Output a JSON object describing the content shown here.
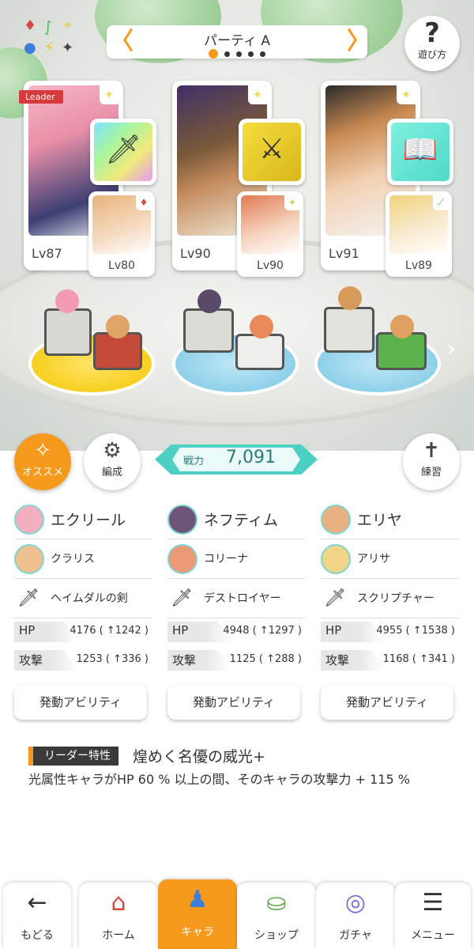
{
  "party": {
    "title": "パーティ A",
    "page_count": 5,
    "active_page": 1
  },
  "help": {
    "label": "遊び方",
    "icon": "question-icon"
  },
  "members": [
    {
      "leader_label": "Leader",
      "level": "Lv87",
      "weapon_icon": "sword-icon",
      "sub_level": "Lv80",
      "sub_badge": "♦"
    },
    {
      "level": "Lv90",
      "weapon_icon": "spear-icon",
      "sub_level": "Lv90",
      "sub_badge": "✦"
    },
    {
      "level": "Lv91",
      "weapon_icon": "book-icon",
      "sub_level": "Lv89",
      "sub_badge": "⟋"
    }
  ],
  "buttons": {
    "recommend": "オススメ",
    "formation": "編成",
    "practice": "練習"
  },
  "power": {
    "label": "戦力",
    "value": "7,091"
  },
  "columns": [
    {
      "main": "エクリール",
      "sub": "クラリス",
      "weapon": "ヘイムダルの剣",
      "hp_label": "HP",
      "hp": "4176 ( ↑1242 )",
      "atk_label": "攻撃",
      "atk": "1253 ( ↑336 )",
      "ability": "発動アビリティ"
    },
    {
      "main": "ネフティム",
      "sub": "コリーナ",
      "weapon": "デストロイヤー",
      "hp_label": "HP",
      "hp": "4948 ( ↑1297 )",
      "atk_label": "攻撃",
      "atk": "1125 ( ↑288 )",
      "ability": "発動アビリティ"
    },
    {
      "main": "エリヤ",
      "sub": "アリサ",
      "weapon": "スクリプチャー",
      "hp_label": "HP",
      "hp": "4955 ( ↑1538 )",
      "atk_label": "攻撃",
      "atk": "1168 ( ↑341 )",
      "ability": "発動アビリティ"
    }
  ],
  "leader_skill": {
    "tag": "リーダー特性",
    "name": "煌めく名優の威光+",
    "description": "光属性キャラがHP 60 % 以上の間、そのキャラの攻撃力 + 115 %"
  },
  "nav": [
    {
      "label": "もどる",
      "icon": "back-arrow-icon",
      "glyph": "←"
    },
    {
      "label": "ホーム",
      "icon": "home-icon",
      "glyph": "⌂"
    },
    {
      "label": "キャラ",
      "icon": "character-icon",
      "glyph": "♟",
      "active": true
    },
    {
      "label": "ショップ",
      "icon": "shop-icon",
      "glyph": "⛀"
    },
    {
      "label": "ガチャ",
      "icon": "gacha-icon",
      "glyph": "◎"
    },
    {
      "label": "メニュー",
      "icon": "menu-icon",
      "glyph": "☰"
    }
  ],
  "colors": {
    "accent": "#f59a1c",
    "power": "#4ecfc3",
    "leader": "#d63a3a"
  }
}
